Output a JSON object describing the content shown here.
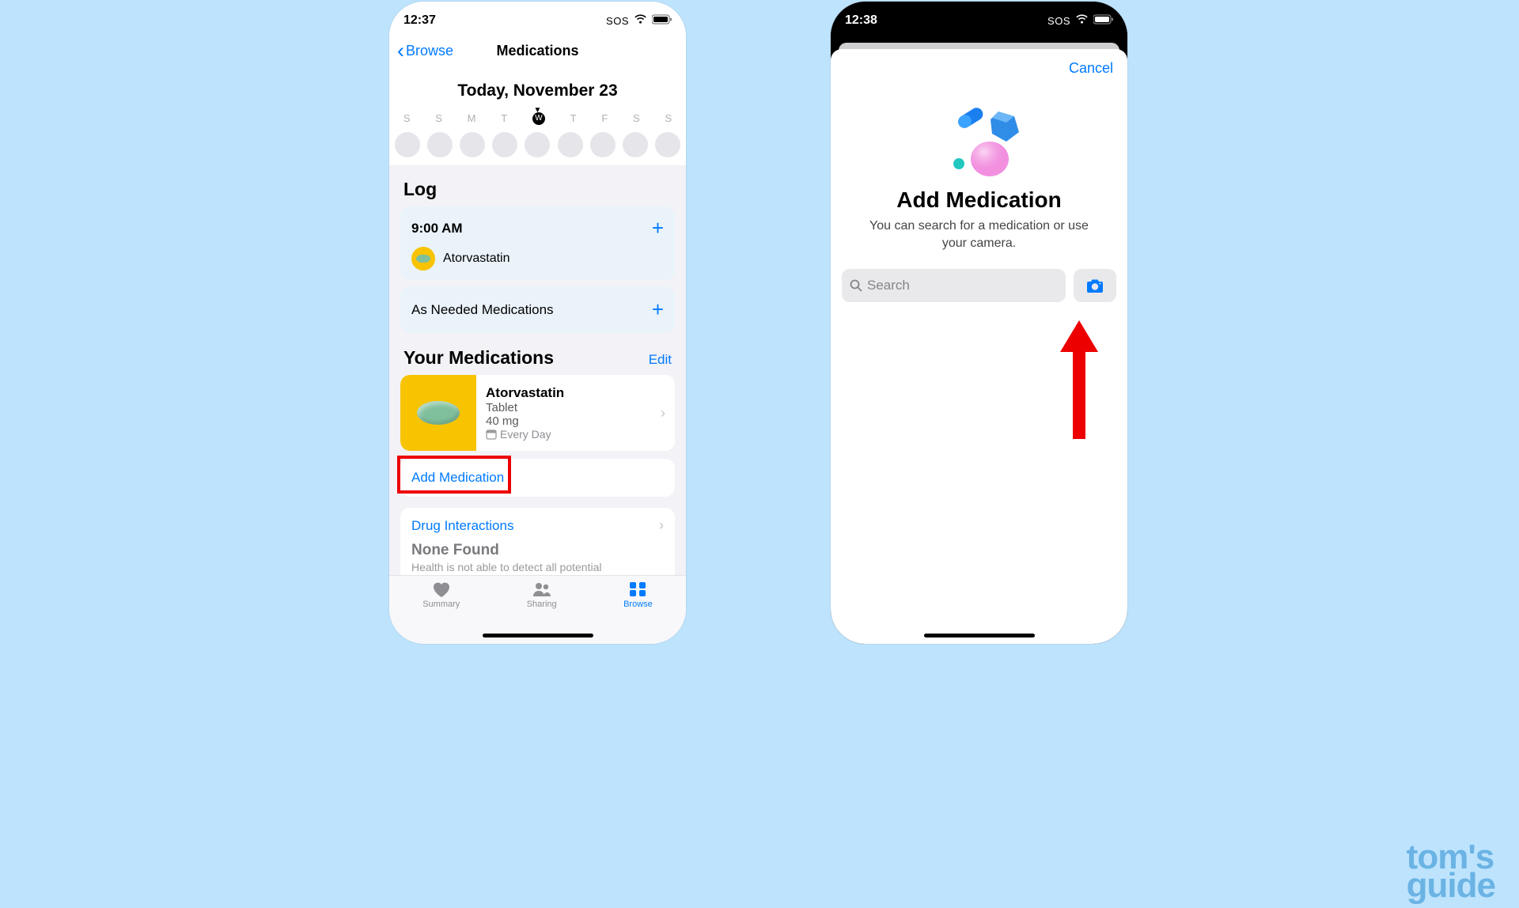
{
  "colors": {
    "page": "#bde3fd",
    "blue": "#007aff",
    "red": "#ed0000"
  },
  "watermark": {
    "line1": "tom's",
    "line2": "guide"
  },
  "left": {
    "status": {
      "time": "12:37",
      "sos": "SOS"
    },
    "nav": {
      "back": "Browse",
      "title": "Medications"
    },
    "dateHeader": "Today, November 23",
    "days": [
      "S",
      "S",
      "M",
      "T",
      "W",
      "T",
      "F",
      "S",
      "S"
    ],
    "todayIndex": 4,
    "todayLetter": "W",
    "log": {
      "sectionTitle": "Log",
      "time": "9:00 AM",
      "med": "Atorvastatin",
      "asNeeded": "As Needed Medications"
    },
    "yourMeds": {
      "title": "Your Medications",
      "edit": "Edit",
      "name": "Atorvastatin",
      "form": "Tablet",
      "strength": "40 mg",
      "frequency": "Every Day"
    },
    "addMedication": "Add Medication",
    "interactions": {
      "title": "Drug Interactions",
      "none": "None Found",
      "detail": "Health is not able to detect all potential"
    },
    "tabs": {
      "summary": "Summary",
      "sharing": "Sharing",
      "browse": "Browse"
    }
  },
  "right": {
    "status": {
      "time": "12:38",
      "sos": "SOS"
    },
    "cancel": "Cancel",
    "title": "Add Medication",
    "desc": "You can search for a medication or use your camera.",
    "search": {
      "placeholder": "Search"
    }
  }
}
